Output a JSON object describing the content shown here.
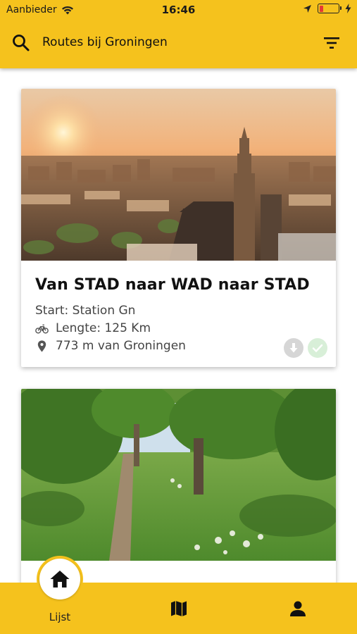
{
  "status_bar": {
    "carrier": "Aanbieder",
    "time": "16:46",
    "battery_color": "#e53935"
  },
  "app_bar": {
    "title": "Routes bij Groningen",
    "search_icon": "search-icon",
    "filter_icon": "filter-icon"
  },
  "routes": [
    {
      "title": "Van STAD naar WAD naar STAD",
      "start": "Start: Station Gn",
      "length": "Lengte: 125 Km",
      "distance": "773 m van Groningen",
      "photo": "city skyline at sunrise with church tower"
    },
    {
      "title": "",
      "photo": "green footpath through meadow with trees"
    }
  ],
  "bottom_nav": {
    "items": [
      {
        "label": "Lijst",
        "icon": "home-icon"
      },
      {
        "label": "",
        "icon": "map-icon"
      },
      {
        "label": "",
        "icon": "profile-icon"
      }
    ]
  },
  "colors": {
    "accent": "#f5c21d",
    "download_badge": "#d6d6d6",
    "check_badge": "#d8efd8"
  }
}
